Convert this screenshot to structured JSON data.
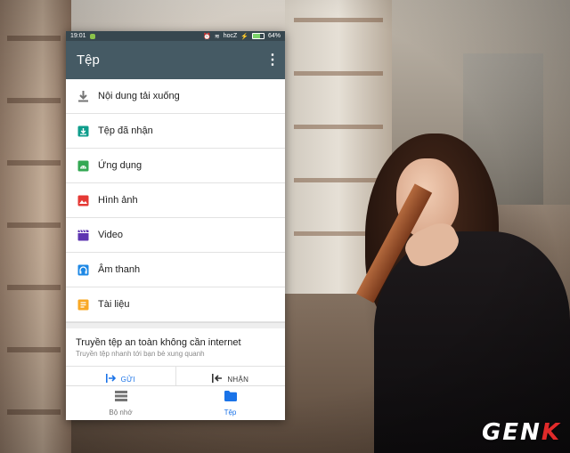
{
  "status_bar": {
    "time": "19:01",
    "carrier": "hocZ",
    "battery": "64%",
    "battery_level": 0.64
  },
  "app_bar": {
    "title": "Tệp",
    "more_icon": "more-vert-icon"
  },
  "categories": [
    {
      "label": "Nội dung tải xuống",
      "icon": "download-icon",
      "color": "#757575"
    },
    {
      "label": "Tệp đã nhận",
      "icon": "received-files-icon",
      "color": "#0f9d8c"
    },
    {
      "label": "Ứng dụng",
      "icon": "android-apps-icon",
      "color": "#34a853"
    },
    {
      "label": "Hình ảnh",
      "icon": "image-icon",
      "color": "#e53935"
    },
    {
      "label": "Video",
      "icon": "video-icon",
      "color": "#5e35b1"
    },
    {
      "label": "Âm thanh",
      "icon": "headphones-icon",
      "color": "#1e88e5"
    },
    {
      "label": "Tài liệu",
      "icon": "document-icon",
      "color": "#f9a825"
    }
  ],
  "share": {
    "title": "Truyền tệp an toàn không cần internet",
    "subtitle": "Truyền tệp nhanh tới bạn bè xung quanh",
    "send_label": "GỬI",
    "receive_label": "NHẬN"
  },
  "bottom_nav": {
    "storage_label": "Bộ nhớ",
    "files_label": "Tệp",
    "active": "files"
  },
  "colors": {
    "appbar": "#455a64",
    "statusbar": "#37474f",
    "accent": "#1a73e8"
  },
  "watermark": "GENK"
}
